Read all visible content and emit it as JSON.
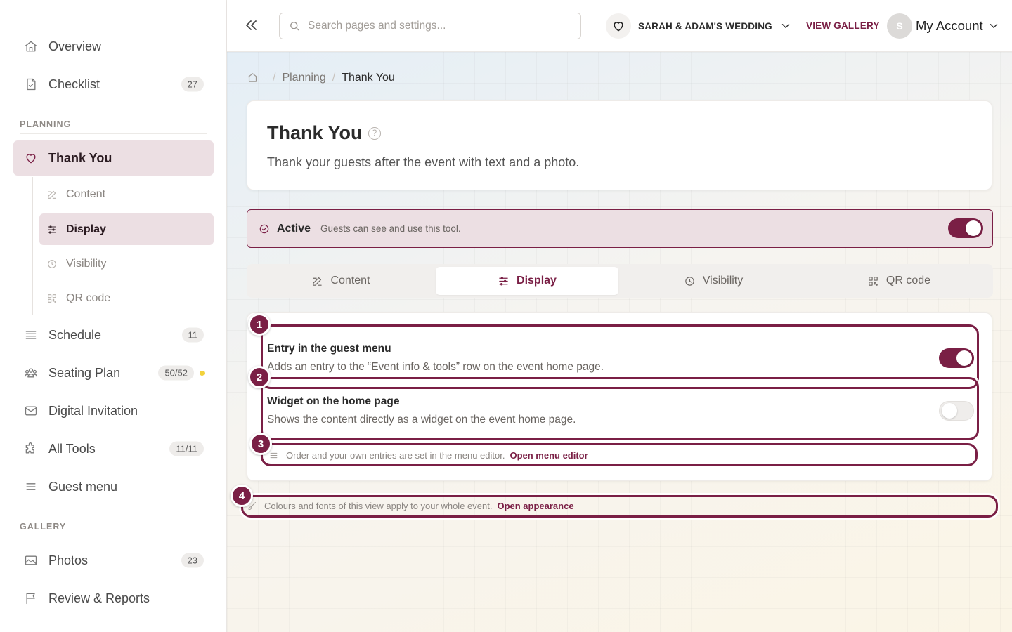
{
  "sidebar": {
    "items": [
      {
        "label": "Overview",
        "icon": "home-icon"
      },
      {
        "label": "Checklist",
        "icon": "checklist-icon",
        "badge": "27"
      }
    ],
    "planning_label": "PLANNING",
    "thank_you": {
      "label": "Thank You",
      "icon": "heart-icon"
    },
    "sub_items": [
      {
        "label": "Content",
        "icon": "edit-icon"
      },
      {
        "label": "Display",
        "icon": "sliders-icon"
      },
      {
        "label": "Visibility",
        "icon": "clock-icon"
      },
      {
        "label": "QR code",
        "icon": "qr-icon"
      }
    ],
    "planning_items": [
      {
        "label": "Schedule",
        "icon": "list-icon",
        "badge": "11"
      },
      {
        "label": "Seating Plan",
        "icon": "people-icon",
        "badge": "50/52"
      },
      {
        "label": "Digital Invitation",
        "icon": "envelope-icon"
      },
      {
        "label": "All Tools",
        "icon": "puzzle-icon",
        "badge": "11/11"
      },
      {
        "label": "Guest menu",
        "icon": "menu-icon"
      }
    ],
    "gallery_label": "GALLERY",
    "gallery_items": [
      {
        "label": "Photos",
        "icon": "image-icon",
        "badge": "23"
      },
      {
        "label": "Review & Reports",
        "icon": "flag-icon"
      }
    ]
  },
  "topbar": {
    "search_placeholder": "Search pages and settings...",
    "event_name": "SARAH & ADAM'S WEDDING",
    "view_gallery": "VIEW GALLERY",
    "avatar_initial": "S",
    "account_label": "My Account"
  },
  "breadcrumb": {
    "parent": "Planning",
    "current": "Thank You"
  },
  "page": {
    "title": "Thank You",
    "help_glyph": "?",
    "subtitle": "Thank your guests after the event with text and a photo."
  },
  "status": {
    "label": "Active",
    "description": "Guests can see and use this tool.",
    "enabled": true
  },
  "tabs": [
    {
      "label": "Content",
      "icon": "edit-icon"
    },
    {
      "label": "Display",
      "icon": "sliders-icon",
      "active": true
    },
    {
      "label": "Visibility",
      "icon": "clock-icon"
    },
    {
      "label": "QR code",
      "icon": "qr-icon"
    }
  ],
  "settings": {
    "entry": {
      "title": "Entry in the guest menu",
      "description": "Adds an entry to the “Event info & tools” row on the event home page.",
      "enabled": true
    },
    "widget": {
      "title": "Widget on the home page",
      "description": "Shows the content directly as a widget on the event home page.",
      "enabled": false
    },
    "menu_note": {
      "text": "Order and your own entries are set in the menu editor.",
      "link": "Open menu editor"
    }
  },
  "appearance_note": {
    "text": "Colours and fonts of this view apply to your whole event.",
    "link": "Open appearance"
  },
  "markers": [
    "1",
    "2",
    "3",
    "4"
  ],
  "colors": {
    "accent": "#7a1f45",
    "accent_soft": "#ecdfe3",
    "seating_dot": "#f2d23c"
  }
}
